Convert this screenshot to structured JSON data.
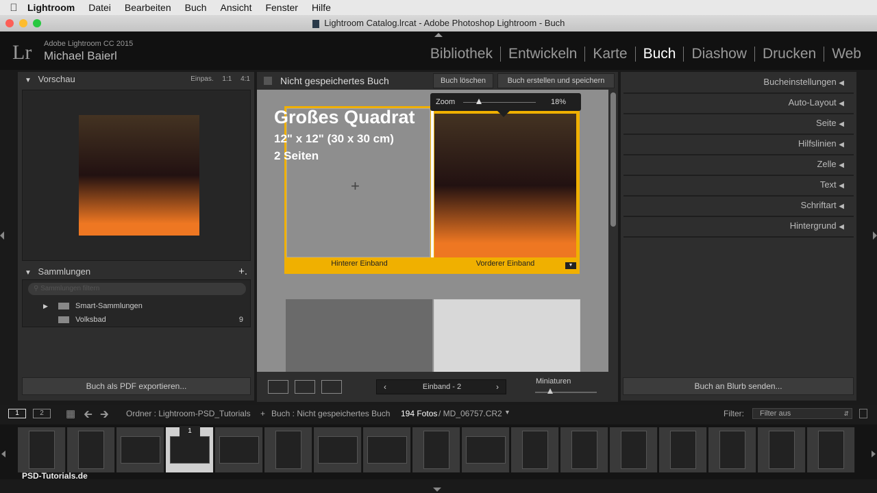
{
  "menubar": {
    "app": "Lightroom",
    "items": [
      "Datei",
      "Bearbeiten",
      "Buch",
      "Ansicht",
      "Fenster",
      "Hilfe"
    ]
  },
  "window": {
    "title": "Lightroom Catalog.lrcat - Adobe Photoshop Lightroom - Buch"
  },
  "identity": {
    "logo": "Lr",
    "version": "Adobe Lightroom CC 2015",
    "user": "Michael Baierl"
  },
  "modules": [
    "Bibliothek",
    "Entwickeln",
    "Karte",
    "Buch",
    "Diashow",
    "Drucken",
    "Web"
  ],
  "left": {
    "preview_title": "Vorschau",
    "preview_opts": [
      "Einpas.",
      "1:1",
      "4:1"
    ],
    "collections_title": "Sammlungen",
    "add": "+.",
    "search_placeholder": "Sammlungen filtern",
    "tree": [
      {
        "label": "Smart-Sammlungen",
        "count": ""
      },
      {
        "label": "Volksbad",
        "count": "9"
      }
    ],
    "export_button": "Buch als PDF exportieren..."
  },
  "center": {
    "book_title": "Nicht gespeichertes Buch",
    "delete_button": "Buch löschen",
    "save_button": "Buch erstellen und speichern",
    "zoom_label": "Zoom",
    "zoom_value": "18%",
    "zoom_level": 18,
    "cover_title": "Großes Quadrat",
    "cover_size": "12\" x 12\" (30 x 30 cm)",
    "cover_pages": "2 Seiten",
    "back_label": "Hinterer Einband",
    "front_label": "Vorderer Einband",
    "page_label": "Einband - 2",
    "thumbs_label": "Miniaturen"
  },
  "right": {
    "items": [
      "Bucheinstellungen",
      "Auto-Layout",
      "Seite",
      "Hilfslinien",
      "Zelle",
      "Text",
      "Schriftart",
      "Hintergrund"
    ],
    "blurb_button": "Buch an Blurb senden..."
  },
  "filmstrip": {
    "pages": [
      "1",
      "2"
    ],
    "source": "Ordner : Lightroom-PSD_Tutorials",
    "book": "Buch : Nicht gespeichertes Buch",
    "count": "194 Fotos",
    "file": "/ MD_06757.CR2",
    "filter_label": "Filter:",
    "filter_value": "Filter aus",
    "badge": "1",
    "watermark": "PSD-Tutorials.de"
  }
}
